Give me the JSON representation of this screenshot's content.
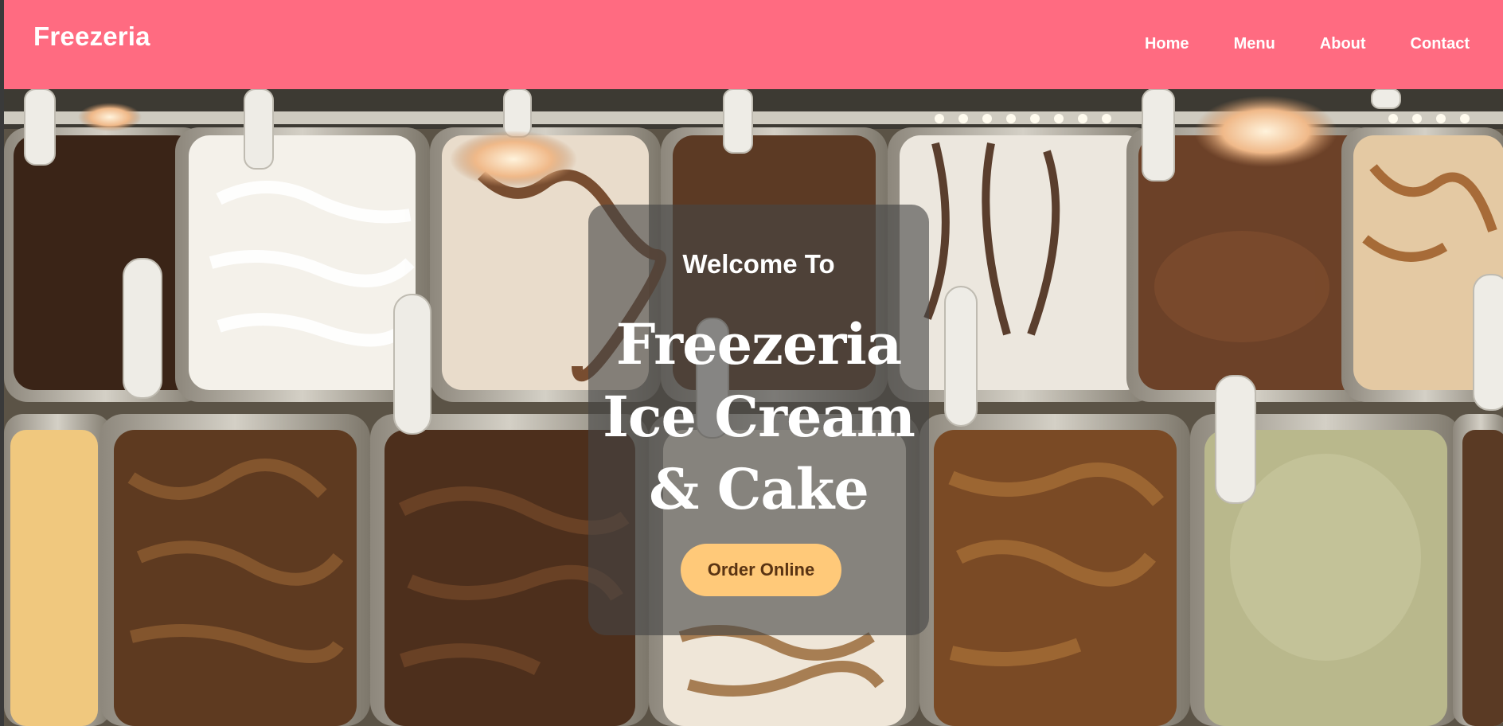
{
  "header": {
    "brand": "Freezeria",
    "nav_items": [
      "Home",
      "Menu",
      "About",
      "Contact"
    ]
  },
  "hero": {
    "welcome": "Welcome To",
    "headline_lines": [
      "Freezeria",
      "Ice Cream",
      "& Cake"
    ],
    "cta_label": "Order Online",
    "background_icon": "ice-cream-display-image"
  },
  "colors": {
    "navbar": "#ff6b81",
    "cta_background": "#ffc979",
    "cta_text": "#5a3413",
    "text": "#ffffff"
  }
}
